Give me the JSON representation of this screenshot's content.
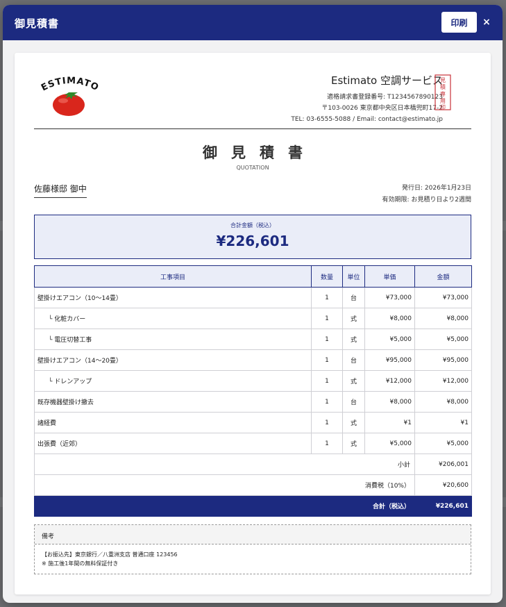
{
  "modal": {
    "title": "御見積書",
    "print_label": "印刷",
    "close_label": "×"
  },
  "logo": {
    "text": "ESTIMATO"
  },
  "company": {
    "name": "Estimato 空調サービス",
    "registration": "適格請求書登録番号: T1234567890123",
    "address": "〒103-0026 東京都中央区日本橋兜町17-2",
    "contact": "TEL: 03-6555-5088 / Email: contact@estimato.jp",
    "seal_text": "見積専用印"
  },
  "document": {
    "title": "御見積書",
    "subtitle": "QUOTATION",
    "client": "佐藤様邸 御中",
    "issue_date": "発行日: 2026年1月23日",
    "validity": "有効期限: お見積り日より2週間"
  },
  "total": {
    "label": "合計金額（税込）",
    "value": "¥226,601"
  },
  "table": {
    "headers": [
      "工事項目",
      "数量",
      "単位",
      "単価",
      "金額"
    ],
    "rows": [
      {
        "name": "壁掛けエアコン（10〜14畳）",
        "qty": "1",
        "unit": "台",
        "price": "¥73,000",
        "amount": "¥73,000"
      },
      {
        "name": "└ 化粧カバー",
        "qty": "1",
        "unit": "式",
        "price": "¥8,000",
        "amount": "¥8,000"
      },
      {
        "name": "└ 電圧切替工事",
        "qty": "1",
        "unit": "式",
        "price": "¥5,000",
        "amount": "¥5,000"
      },
      {
        "name": "壁掛けエアコン（14〜20畳）",
        "qty": "1",
        "unit": "台",
        "price": "¥95,000",
        "amount": "¥95,000"
      },
      {
        "name": "└ ドレンアップ",
        "qty": "1",
        "unit": "式",
        "price": "¥12,000",
        "amount": "¥12,000"
      },
      {
        "name": "既存機器壁掛け撤去",
        "qty": "1",
        "unit": "台",
        "price": "¥8,000",
        "amount": "¥8,000"
      },
      {
        "name": "諸経費",
        "qty": "1",
        "unit": "式",
        "price": "¥1",
        "amount": "¥1"
      },
      {
        "name": "出張費（近郊）",
        "qty": "1",
        "unit": "式",
        "price": "¥5,000",
        "amount": "¥5,000"
      }
    ],
    "subtotal_label": "小計",
    "subtotal_value": "¥206,001",
    "tax_label": "消費税（10%）",
    "tax_value": "¥20,600",
    "grand_label": "合計（税込）",
    "grand_value": "¥226,601"
  },
  "notes": {
    "heading": "備考",
    "line1": "【お振込先】東京銀行／八重洲支店 普通口座 123456",
    "line2": "※ 施工後1年間の無料保証付き"
  },
  "colors": {
    "brand_navy": "#1c2a80",
    "light_fill": "#eaedf8",
    "tomato_red": "#d9261c",
    "seal_red": "#c8323a"
  }
}
